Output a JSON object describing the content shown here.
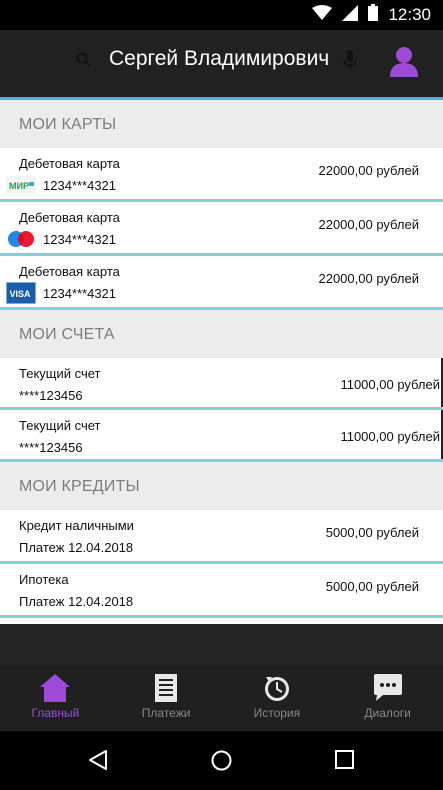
{
  "status_bar": {
    "time": "12:30"
  },
  "header": {
    "title": "Сергей Владимирович"
  },
  "sections": {
    "cards": {
      "title": "МОИ КАРТЫ"
    },
    "accounts": {
      "title": "МОИ СЧЕТА"
    },
    "credits": {
      "title": "МОИ КРЕДИТЫ"
    }
  },
  "cards": [
    {
      "title": "Дебетовая карта",
      "number": "1234***4321",
      "amount": "22000,00 рублей",
      "logo": "МИР",
      "logo_color": "#1ba44a"
    },
    {
      "title": "Дебетовая карта",
      "number": "1234***4321",
      "amount": "22000,00 рублей",
      "logo": "mastercard",
      "logo_color": "#eb001b"
    },
    {
      "title": "Дебетовая карта",
      "number": "1234***4321",
      "amount": "22000,00 рублей",
      "logo": "VISA",
      "logo_color": "#1a5da9"
    }
  ],
  "accounts": [
    {
      "title": "Текущий счет",
      "number": "****123456",
      "amount": "11000,00 рублей"
    },
    {
      "title": "Текущий счет",
      "number": "****123456",
      "amount": "11000,00 рублей"
    }
  ],
  "credits": [
    {
      "title": "Кредит наличными",
      "payment": "Платеж 12.04.2018",
      "amount": "5000,00 рублей"
    },
    {
      "title": "Ипотека",
      "payment": "Платеж 12.04.2018",
      "amount": "5000,00 рублей"
    }
  ],
  "nav": {
    "items": [
      {
        "label": "Главный",
        "icon": "home-icon"
      },
      {
        "label": "Платежи",
        "icon": "receipt-icon"
      },
      {
        "label": "История",
        "icon": "history-icon"
      },
      {
        "label": "Диалоги",
        "icon": "chat-icon"
      }
    ],
    "active_color": "#9d4bd6"
  },
  "colors": {
    "accent": "#9d4bd6",
    "divider": "#7ed3d6",
    "header_bg": "#212121"
  }
}
